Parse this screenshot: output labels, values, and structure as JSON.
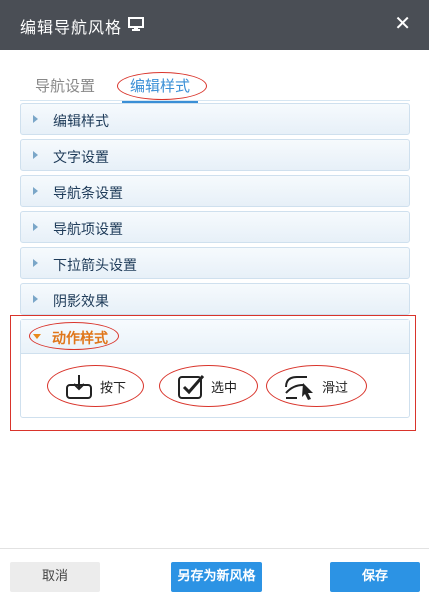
{
  "dialog": {
    "title": "编辑导航风格",
    "title_icon": "monitor-icon",
    "close_symbol": "✕"
  },
  "tabs": [
    {
      "label": "导航设置",
      "active": false
    },
    {
      "label": "编辑样式",
      "active": true
    }
  ],
  "panels": [
    {
      "label": "编辑样式"
    },
    {
      "label": "文字设置"
    },
    {
      "label": "导航条设置"
    },
    {
      "label": "导航项设置"
    },
    {
      "label": "下拉箭头设置"
    },
    {
      "label": "阴影效果"
    }
  ],
  "action_panel": {
    "label": "动作样式",
    "options": [
      {
        "label": "按下",
        "icon": "press-icon"
      },
      {
        "label": "选中",
        "icon": "checkbox-icon"
      },
      {
        "label": "滑过",
        "icon": "hover-cursor-icon"
      }
    ]
  },
  "footer": {
    "cancel": "取消",
    "save_as": "另存为新风格",
    "save": "保存"
  },
  "colors": {
    "titlebar": "#4a4e55",
    "accent": "#2c93e4",
    "highlight_text": "#e0761a",
    "annotation": "#d9342b"
  }
}
